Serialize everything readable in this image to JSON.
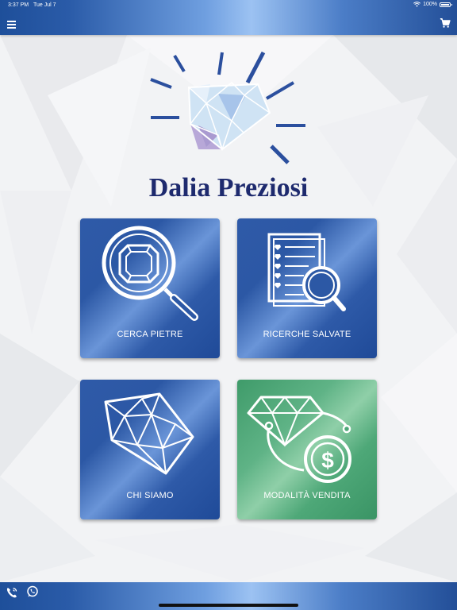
{
  "status_bar": {
    "time": "3:37 PM",
    "date": "Tue Jul 7",
    "battery": "100%"
  },
  "header": {
    "menu_icon": "hamburger-menu-icon",
    "cart_icon": "shopping-cart-icon"
  },
  "brand": {
    "title": "Dalia Preziosi"
  },
  "tiles": [
    {
      "label": "CERCA PIETRE",
      "icon": "magnifier-gem-icon",
      "color": "#2c58a5"
    },
    {
      "label": "RICERCHE SALVATE",
      "icon": "document-search-icon",
      "color": "#2c58a5"
    },
    {
      "label": "CHI SIAMO",
      "icon": "diamond-icon",
      "color": "#2c58a5"
    },
    {
      "label": "MODALITÀ VENDITA",
      "icon": "diamond-dollar-icon",
      "color": "#4ea878"
    }
  ],
  "footer": {
    "phone_icon": "phone-icon",
    "whatsapp_icon": "whatsapp-icon"
  },
  "colors": {
    "brand_navy": "#1e2a6e",
    "bar_blue": "#2a5ba8",
    "tile_green": "#4ea878"
  }
}
